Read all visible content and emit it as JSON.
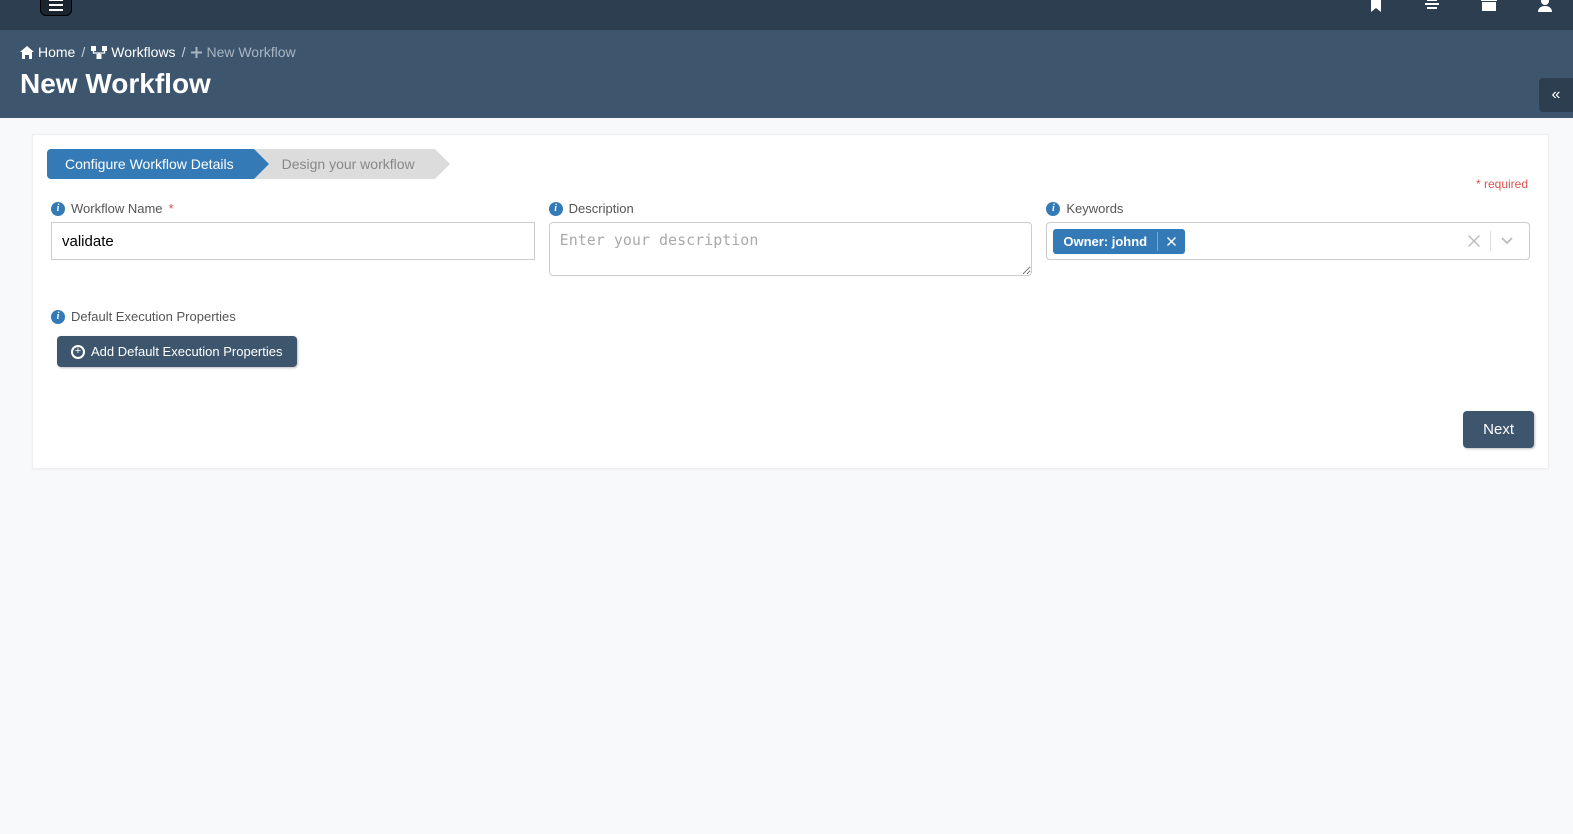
{
  "breadcrumb": {
    "home": "Home",
    "workflows": "Workflows",
    "current": "New Workflow"
  },
  "page_title": "New Workflow",
  "steps": {
    "configure": "Configure Workflow Details",
    "design": "Design your workflow"
  },
  "required_label": "* required",
  "fields": {
    "workflow_name": {
      "label": "Workflow Name",
      "value": "validate"
    },
    "description": {
      "label": "Description",
      "placeholder": "Enter your description",
      "value": ""
    },
    "keywords": {
      "label": "Keywords",
      "tags": [
        {
          "label": "Owner: johnd"
        }
      ]
    },
    "default_exec": {
      "label": "Default Execution Properties",
      "button": "Add Default Execution Properties"
    }
  },
  "buttons": {
    "next": "Next"
  }
}
